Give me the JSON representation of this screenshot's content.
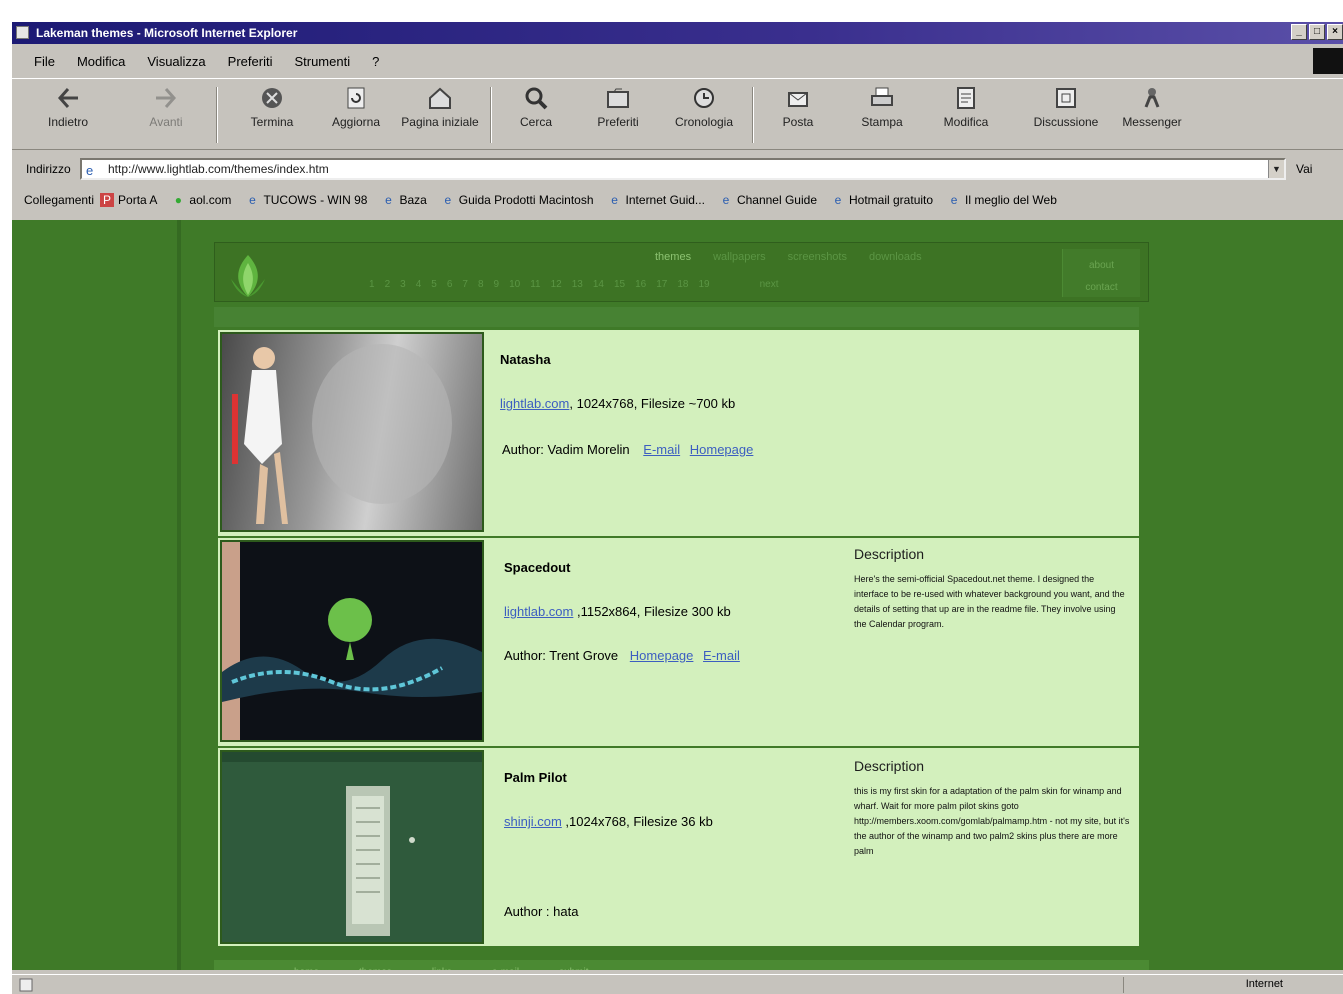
{
  "window": {
    "title": "Lakeman themes - Microsoft Internet Explorer",
    "controls": [
      "_",
      "□",
      "×"
    ]
  },
  "menu": [
    "File",
    "Modifica",
    "Visualizza",
    "Preferiti",
    "Strumenti",
    "?"
  ],
  "toolbar": {
    "back": "Indietro",
    "forward": "Avanti",
    "stop": "Termina",
    "refresh": "Aggiorna",
    "home": "Pagina iniziale",
    "search": "Cerca",
    "favorites": "Preferiti",
    "history": "Cronologia",
    "mail": "Posta",
    "print": "Stampa",
    "edit": "Modifica",
    "discuss": "Discussione",
    "messenger": "Messenger"
  },
  "address": {
    "label": "Indirizzo",
    "url": "http://www.lightlab.com/themes/index.htm",
    "go": "Vai"
  },
  "links": {
    "label": "Collegamenti",
    "items": [
      "Porta A",
      "aol.com",
      "TUCOWS - WIN 98",
      "Baza",
      "Guida Prodotti Macintosh",
      "Internet Guid...",
      "Channel Guide",
      "Hotmail gratuito",
      "Il meglio del Web"
    ]
  },
  "site": {
    "nav_top": [
      "themes",
      "wallpapers",
      "screenshots",
      "downloads"
    ],
    "pages": [
      "1",
      "2",
      "3",
      "4",
      "5",
      "6",
      "7",
      "8",
      "9",
      "10",
      "11",
      "12",
      "13",
      "14",
      "15",
      "16",
      "17",
      "18",
      "19"
    ],
    "next": "next",
    "side": [
      "about",
      "contact"
    ],
    "footer": [
      "home",
      "themes",
      "links",
      "e-mail",
      "submit"
    ]
  },
  "themes": [
    {
      "title": "Natasha",
      "link_text": "lightlab.com",
      "meta": ", 1024x768, Filesize ~700 kb",
      "author_label": "Author: Vadim Morelin",
      "author_links": [
        "E-mail",
        "Homepage"
      ]
    },
    {
      "title": "Spacedout",
      "link_text": "lightlab.com",
      "meta": " ,1152x864, Filesize 300 kb",
      "author_label": "Author: Trent Grove",
      "author_links": [
        "Homepage",
        "E-mail"
      ],
      "desc_title": "Description",
      "desc_body": "Here's the semi-official Spacedout.net theme. I designed the interface to be re-used with whatever background you want, and the details of setting that up are in the readme file. They involve using the Calendar program."
    },
    {
      "title": "Palm Pilot",
      "link_text": "shinji.com",
      "meta": " ,1024x768, Filesize 36 kb",
      "author_label": "Author : hata",
      "desc_title": "Description",
      "desc_body": "this is my first skin for a adaptation of the palm skin for winamp and wharf. Wait for more palm pilot skins goto http://members.xoom.com/gomlab/palmamp.htm - not my site, but it's the author of the winamp and two palm2 skins plus there are more palm"
    }
  ],
  "status": {
    "zone": "Internet"
  }
}
